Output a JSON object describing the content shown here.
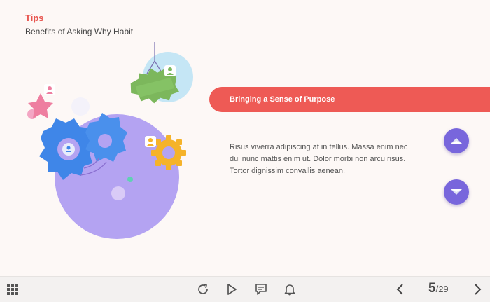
{
  "header": {
    "title": "Tips",
    "subtitle": "Benefits of Asking Why Habit"
  },
  "content": {
    "banner_label": "Bringing a Sense of Purpose",
    "body_lines": [
      "Risus viverra adipiscing at in tellus. Massa enim nec",
      "dui nunc mattis enim ut. Dolor morbi non arcu risus.",
      "Tortor dignissim convallis aenean."
    ]
  },
  "navigation": {
    "up_icon": "chevron-up-icon",
    "down_icon": "chevron-down-icon"
  },
  "toolbar": {
    "icons": [
      "grid-menu-icon",
      "replay-icon",
      "play-icon",
      "comment-icon",
      "bell-icon",
      "prev-icon",
      "next-icon"
    ],
    "page_current": "5",
    "page_separator": "/",
    "page_total": "29"
  },
  "colors": {
    "accent": "#ee5a55",
    "nav_button": "#7866dc",
    "background": "#fdf8f6"
  }
}
